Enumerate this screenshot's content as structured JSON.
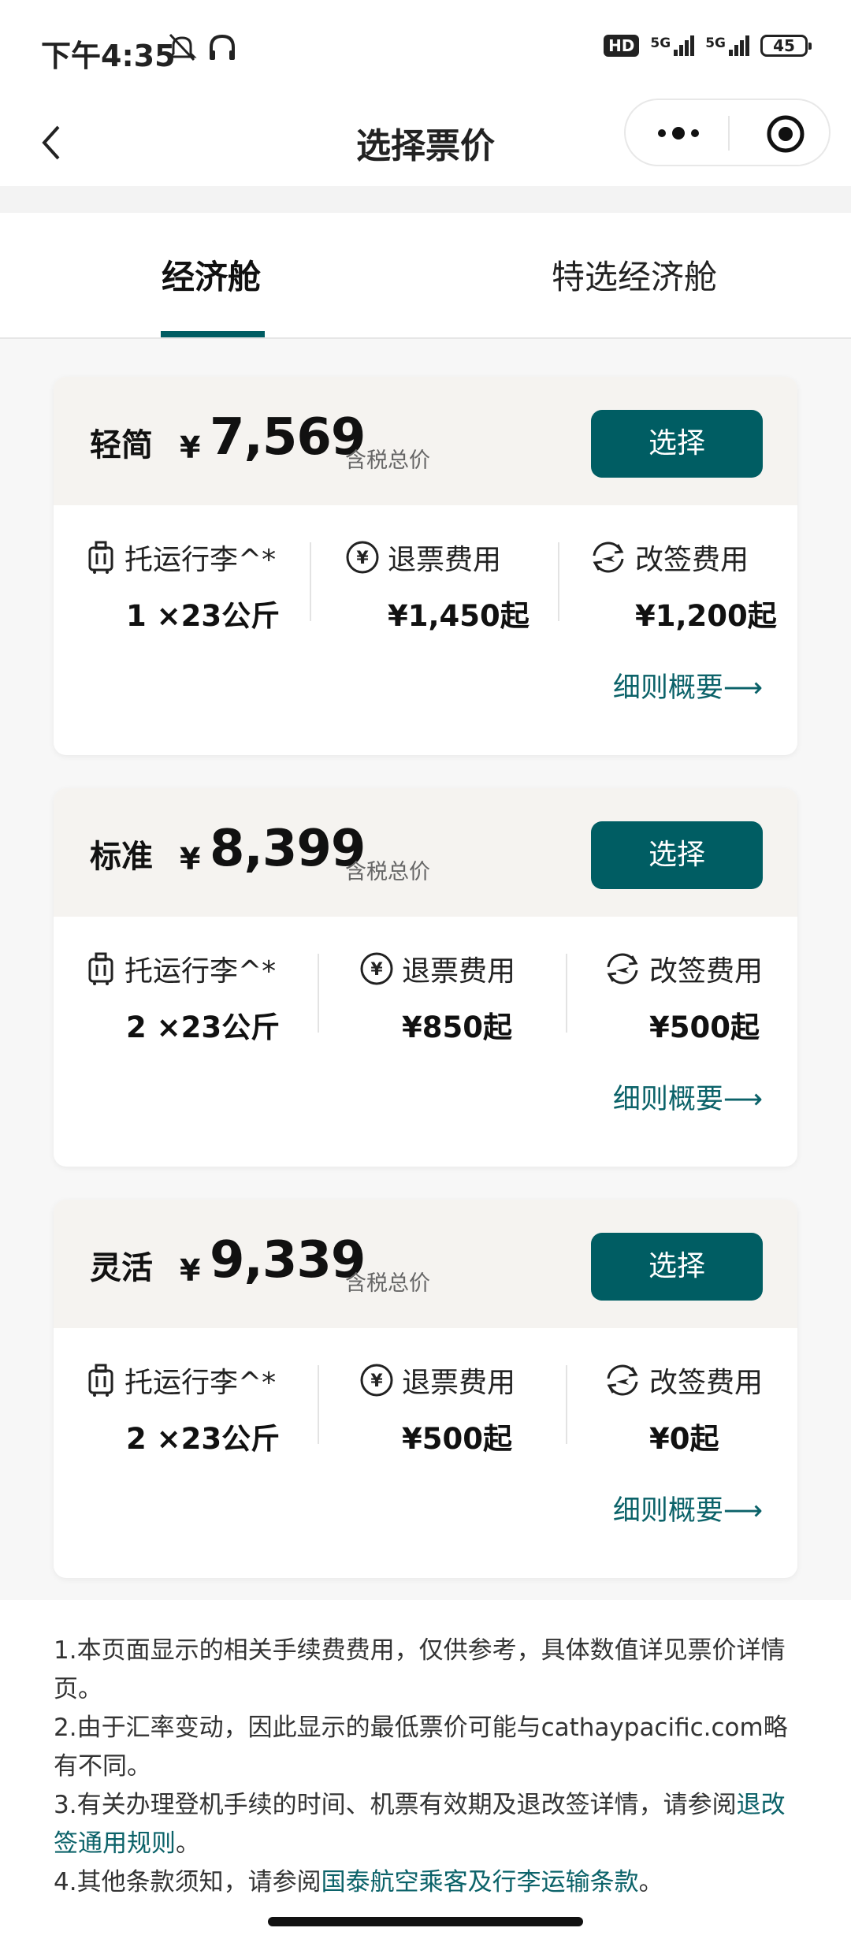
{
  "status_bar": {
    "time": "下午4:35",
    "hd_badge": "HD",
    "network_1": "5G",
    "network_2": "5G",
    "battery": "45",
    "icons": [
      "mute-bell-icon",
      "headphones-icon",
      "signal-icon",
      "battery-icon"
    ]
  },
  "nav": {
    "title": "选择票价",
    "icons": [
      "back-arrow-icon",
      "more-dots-icon",
      "close-target-icon"
    ]
  },
  "tabs": [
    {
      "label": "经济舱",
      "active": true
    },
    {
      "label": "特选经济舱",
      "active": false
    }
  ],
  "fares": [
    {
      "name": "轻简",
      "currency": "¥",
      "price": "7,569",
      "note": "含税总价",
      "button": "选择",
      "features": [
        {
          "icon": "luggage-icon",
          "title": "托运行李^*",
          "value": "1 ×23公斤"
        },
        {
          "icon": "yen-circle-icon",
          "title": "退票费用",
          "value": "¥1,450起"
        },
        {
          "icon": "plane-change-icon",
          "title": "改签费用",
          "value": "¥1,200起"
        }
      ],
      "details": "细则概要⟶"
    },
    {
      "name": "标准",
      "currency": "¥",
      "price": "8,399",
      "note": "含税总价",
      "button": "选择",
      "features": [
        {
          "icon": "luggage-icon",
          "title": "托运行李^*",
          "value": "2 ×23公斤"
        },
        {
          "icon": "yen-circle-icon",
          "title": "退票费用",
          "value": "¥850起"
        },
        {
          "icon": "plane-change-icon",
          "title": "改签费用",
          "value": "¥500起"
        }
      ],
      "details": "细则概要⟶"
    },
    {
      "name": "灵活",
      "currency": "¥",
      "price": "9,339",
      "note": "含税总价",
      "button": "选择",
      "features": [
        {
          "icon": "luggage-icon",
          "title": "托运行李^*",
          "value": "2 ×23公斤"
        },
        {
          "icon": "yen-circle-icon",
          "title": "退票费用",
          "value": "¥500起"
        },
        {
          "icon": "plane-change-icon",
          "title": "改签费用",
          "value": "¥0起"
        }
      ],
      "details": "细则概要⟶"
    }
  ],
  "notes": {
    "n1": "1.本页面显示的相关手续费费用，仅供参考，具体数值详见票价详情页。",
    "n2": "2.由于汇率变动，因此显示的最低票价可能与cathaypacific.com略有不同。",
    "n3_text": "3.有关办理登机手续的时间、机票有效期及退改签详情，请参阅",
    "n3_link": "退改签通用规则",
    "n3_end": "。",
    "n4_text": "4.其他条款须知，请参阅",
    "n4_link": "国泰航空乘客及行李运输条款",
    "n4_end": "。"
  },
  "colors": {
    "accent": "#005d63",
    "link": "#0b6269",
    "card_header": "#f5f3f0",
    "page_bg": "#f7f7f7"
  }
}
